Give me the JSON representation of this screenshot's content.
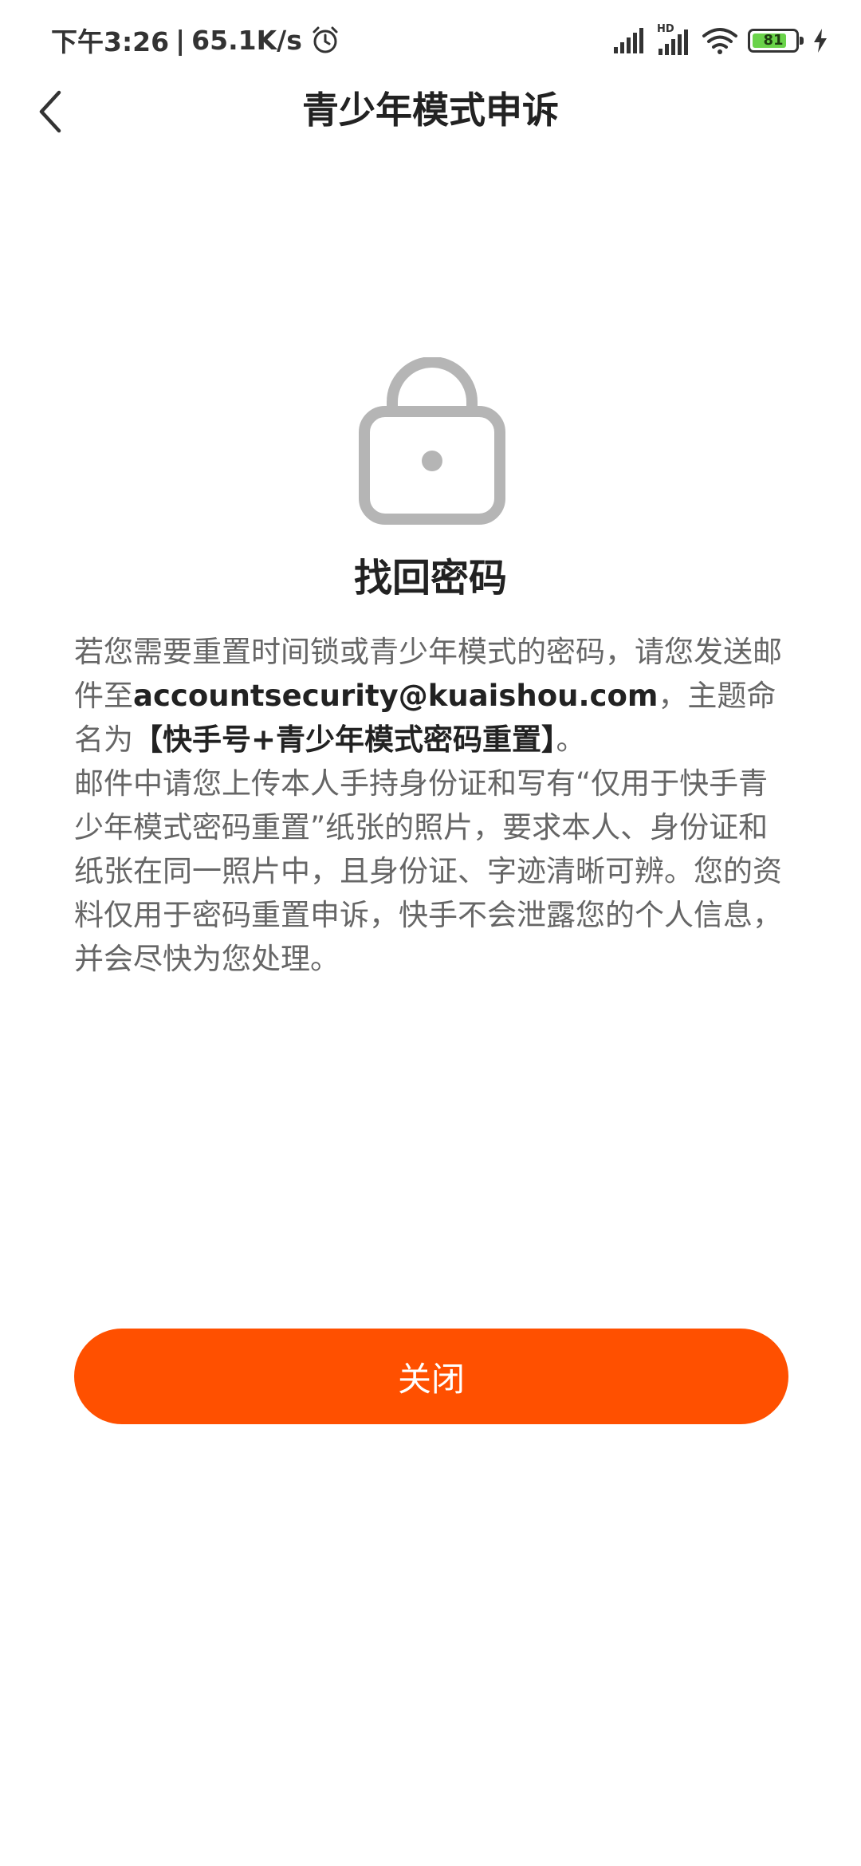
{
  "status_bar": {
    "time": "下午3:26",
    "separator": "|",
    "network_speed": "65.1K/s",
    "icons": [
      "alarm-icon",
      "signal-icon",
      "signal-hd-icon",
      "wifi-icon",
      "battery-icon",
      "charging-icon"
    ],
    "signal_hd_label": "HD",
    "battery_level": "81",
    "battery_fraction": 0.81,
    "battery_color": "#6ad34a"
  },
  "nav": {
    "back_icon": "chevron-left-icon",
    "title": "青少年模式申诉"
  },
  "main": {
    "lock_icon": "lock-icon",
    "heading": "找回密码",
    "paragraph1": {
      "text_a": "若您需要重置时间锁或青少年模式的密码，请您发送邮件至",
      "email": "accountsecurity@kuaishou.com",
      "text_b": "，主题命名为",
      "subject": "【快手号+青少年模式密码重置】",
      "text_c": "。"
    },
    "paragraph2": "邮件中请您上传本人手持身份证和写有“仅用于快手青少年模式密码重置”纸张的照片，要求本人、身份证和纸张在同一照片中，且身份证、字迹清晰可辨。您的资料仅用于密码重置申诉，快手不会泄露您的个人信息，并会尽快为您处理。"
  },
  "close_button": {
    "label": "关闭",
    "color": "#ff5000"
  }
}
